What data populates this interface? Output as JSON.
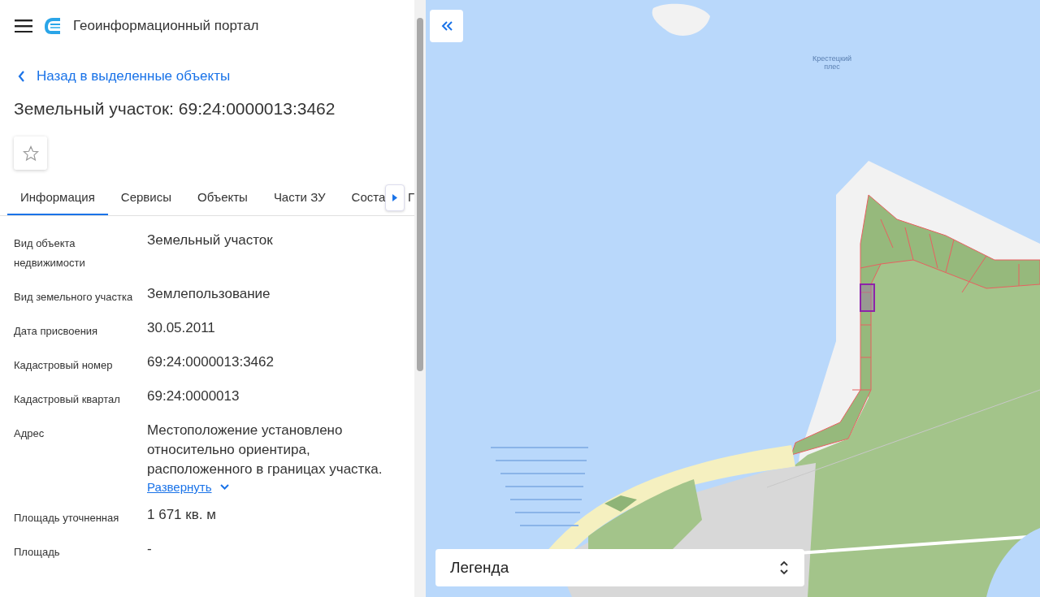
{
  "header": {
    "title": "Геоинформационный портал"
  },
  "back_link": "Назад в выделенные объекты",
  "title": "Земельный участок: 69:24:0000013:3462",
  "favorite": {
    "on": false
  },
  "tabs": [
    {
      "label": "Информация",
      "selected": true
    },
    {
      "label": "Сервисы",
      "selected": false
    },
    {
      "label": "Объекты",
      "selected": false
    },
    {
      "label": "Части ЗУ",
      "selected": false
    },
    {
      "label": "Соста",
      "selected": false
    },
    {
      "label": "Г",
      "selected": false
    }
  ],
  "fields": [
    {
      "label": "Вид объекта недвижимости",
      "value": "Земельный участок"
    },
    {
      "label": "Вид земельного участка",
      "value": "Землепользование"
    },
    {
      "label": "Дата присвоения",
      "value": "30.05.2011"
    },
    {
      "label": "Кадастровый номер",
      "value": "69:24:0000013:3462"
    },
    {
      "label": "Кадастровый квартал",
      "value": "69:24:0000013"
    },
    {
      "label": "Адрес",
      "value": "Местоположение установлено относительно ориентира, расположенного в границах участка.",
      "expand_link": "Развернуть"
    },
    {
      "label": "Площадь уточненная",
      "value": "1 671 кв. м"
    },
    {
      "label": "Площадь",
      "value": "-"
    }
  ],
  "map": {
    "label": "Крестецкий плес",
    "legend": "Легенда"
  }
}
